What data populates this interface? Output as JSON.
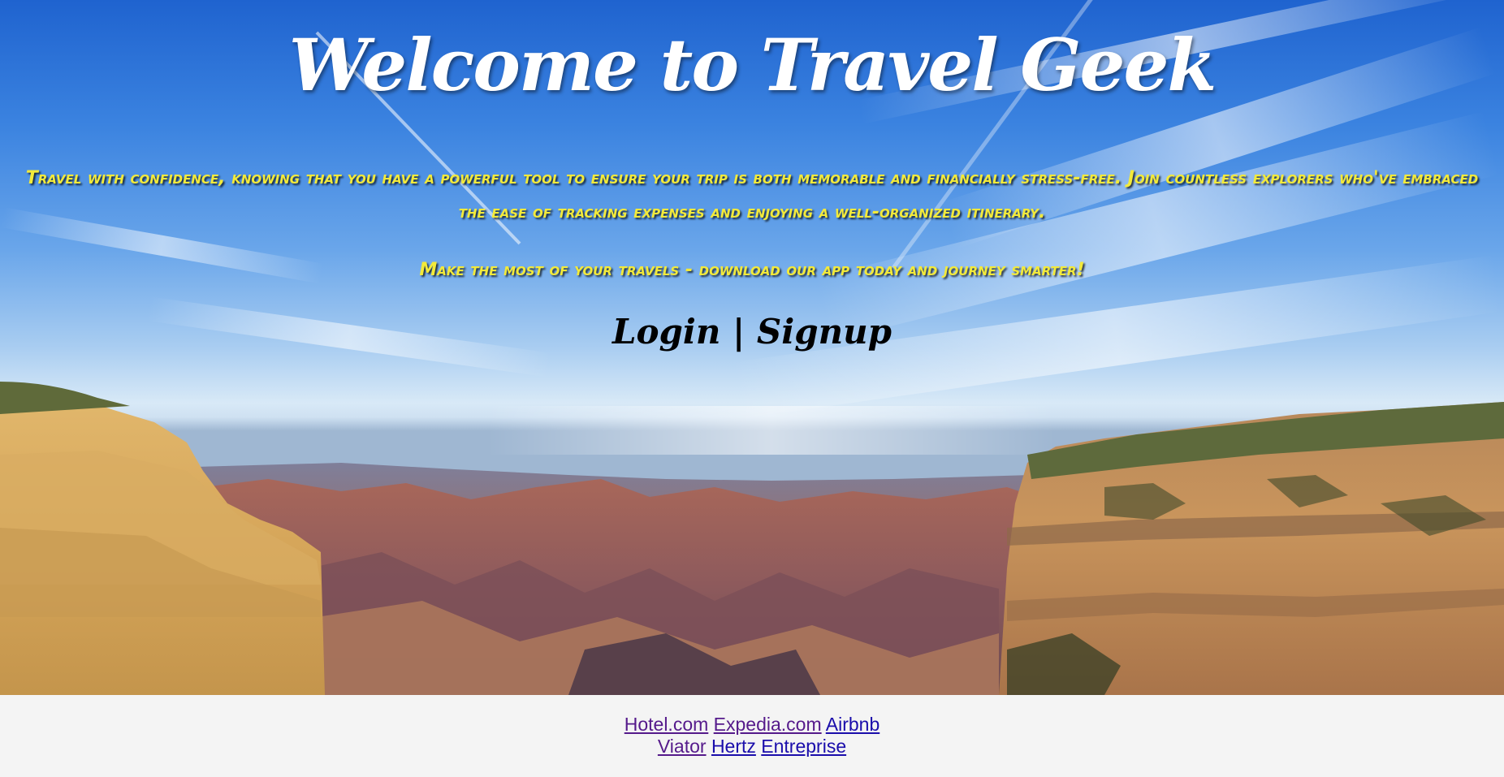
{
  "hero": {
    "title": "Welcome to Travel Geek",
    "paragraph1": "Travel with confidence, knowing that you have a powerful tool to ensure your trip is both memorable and financially stress-free. Join countless explorers who've embraced the ease of tracking expenses and enjoying a well-organized itinerary.",
    "paragraph2": "Make the most of your travels - download our app today and journey smarter!",
    "login_label": "Login",
    "separator": "|",
    "signup_label": "Signup",
    "background_image": "grand-canyon-landscape"
  },
  "footer": {
    "row1": [
      {
        "label": "Hotel.com",
        "color": "#551a8b"
      },
      {
        "label": "Expedia.com",
        "color": "#551a8b"
      },
      {
        "label": "Airbnb",
        "color": "#1a0dab"
      }
    ],
    "row2": [
      {
        "label": "Viator",
        "color": "#551a8b"
      },
      {
        "label": "Hertz",
        "color": "#1a0dab"
      },
      {
        "label": "Entreprise",
        "color": "#1a0dab"
      }
    ]
  },
  "colors": {
    "title": "#ffffff",
    "tagline": "#f3ea3a",
    "auth": "#000000",
    "footer_bg": "#f4f4f4"
  }
}
